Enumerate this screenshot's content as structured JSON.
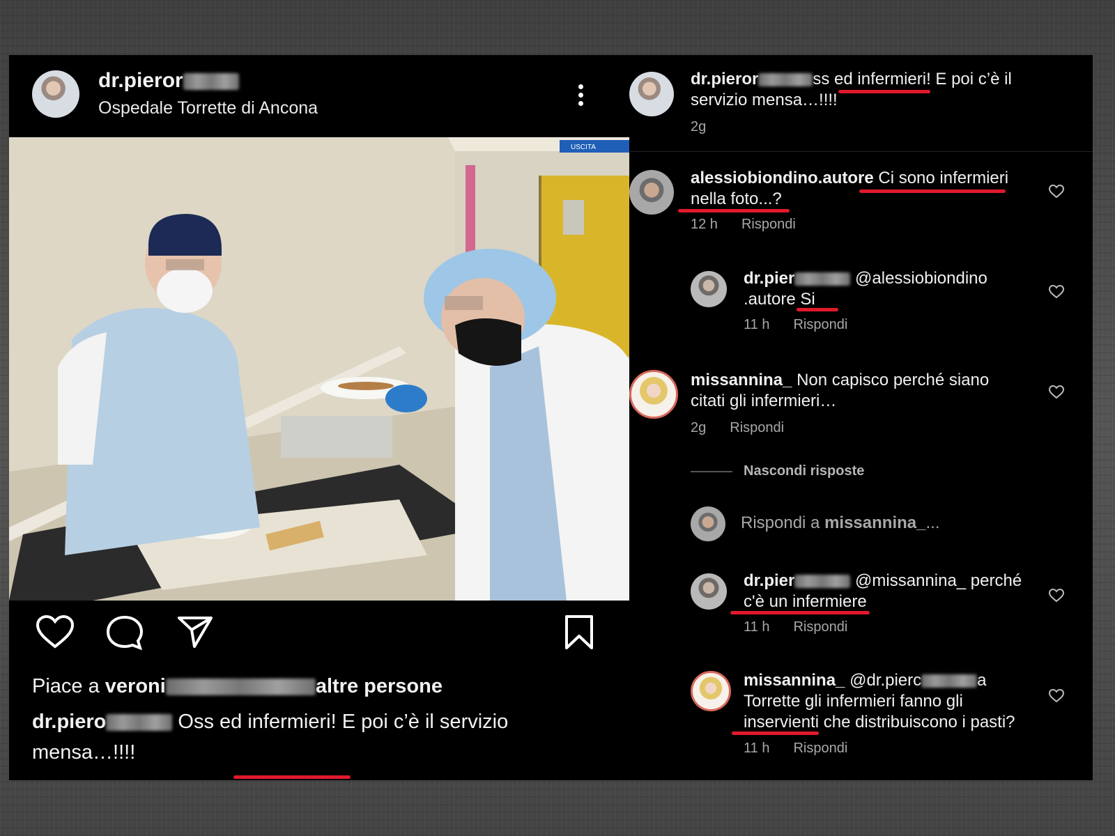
{
  "post": {
    "username": "dr.pieror",
    "location": "Ospedale Torrette di Ancona",
    "photo_sign": "USCITA",
    "likes_prefix": "Piace a ",
    "likes_user": "veroni",
    "likes_suffix": "altre persone",
    "caption_user": "dr.piero",
    "caption_text": "Oss ed infermieri! E poi c’è il servizio mensa…!!!!"
  },
  "comments": [
    {
      "user": "dr.pieror",
      "text": "ss ed infermieri! E poi c’è il servizio mensa…!!!!",
      "time": "2g"
    },
    {
      "user": "alessiobiondino.autore",
      "text": "Ci sono infermieri nella foto...?",
      "time": "12 h",
      "reply": "Rispondi"
    },
    {
      "user": "dr.pier",
      "text": "@alessiobiondino .autore Si",
      "time": "11 h",
      "reply": "Rispondi"
    },
    {
      "user": "missannina_",
      "text": "Non capisco perché siano citati gli infermieri…",
      "time": "2g",
      "reply": "Rispondi"
    },
    {
      "user": "dr.pier",
      "text": "@missannina_ perché c'è un infermiere",
      "time": "11 h",
      "reply": "Rispondi"
    },
    {
      "user": "missannina_",
      "text_pre": "@dr.pierc",
      "text_post": "a Torrette gli infermieri fanno gli inservienti che distribuiscono i pasti?",
      "time": "11 h",
      "reply": "Rispondi"
    }
  ],
  "hide_replies": "Nascondi risposte",
  "reply_to": {
    "prefix": "Rispondi a ",
    "user": "missannina_",
    "suffix": "..."
  },
  "icons": [
    "more-options-icon",
    "heart-icon",
    "comment-icon",
    "share-icon",
    "bookmark-icon",
    "heart-small-icon"
  ],
  "colors": {
    "background": "#000000",
    "highlight_underline": "#e01a2b",
    "meta_text": "#a8a8a8"
  }
}
